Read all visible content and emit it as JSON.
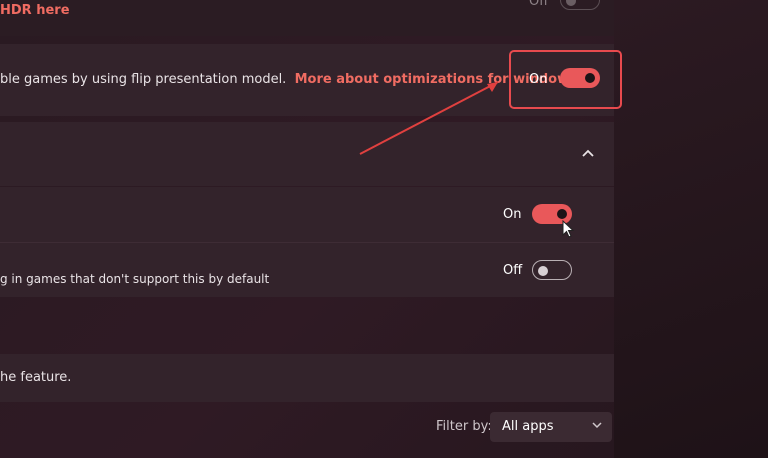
{
  "top_row": {
    "link_text": "HDR here",
    "state": "Off"
  },
  "optimizations_row": {
    "description": "ble games by using flip presentation model.",
    "link_text": "More about optimizations for windowed",
    "state": "On",
    "toggle_on": true
  },
  "row_one": {
    "state": "On",
    "toggle_on": true
  },
  "row_two": {
    "description": "g in games that don't support this by default",
    "state": "Off",
    "toggle_on": false
  },
  "feature_row": {
    "text": "he feature."
  },
  "filter": {
    "label": "Filter by:",
    "value": "All apps"
  },
  "icons": {
    "expand": "chevron-up-icon",
    "dropdown": "chevron-down-icon",
    "cursor": "mouse-pointer-icon",
    "annotation": "red-arrow-annotation"
  },
  "colors": {
    "accent": "#e9585a",
    "link": "#f06c62",
    "highlight": "#e84a4e"
  }
}
